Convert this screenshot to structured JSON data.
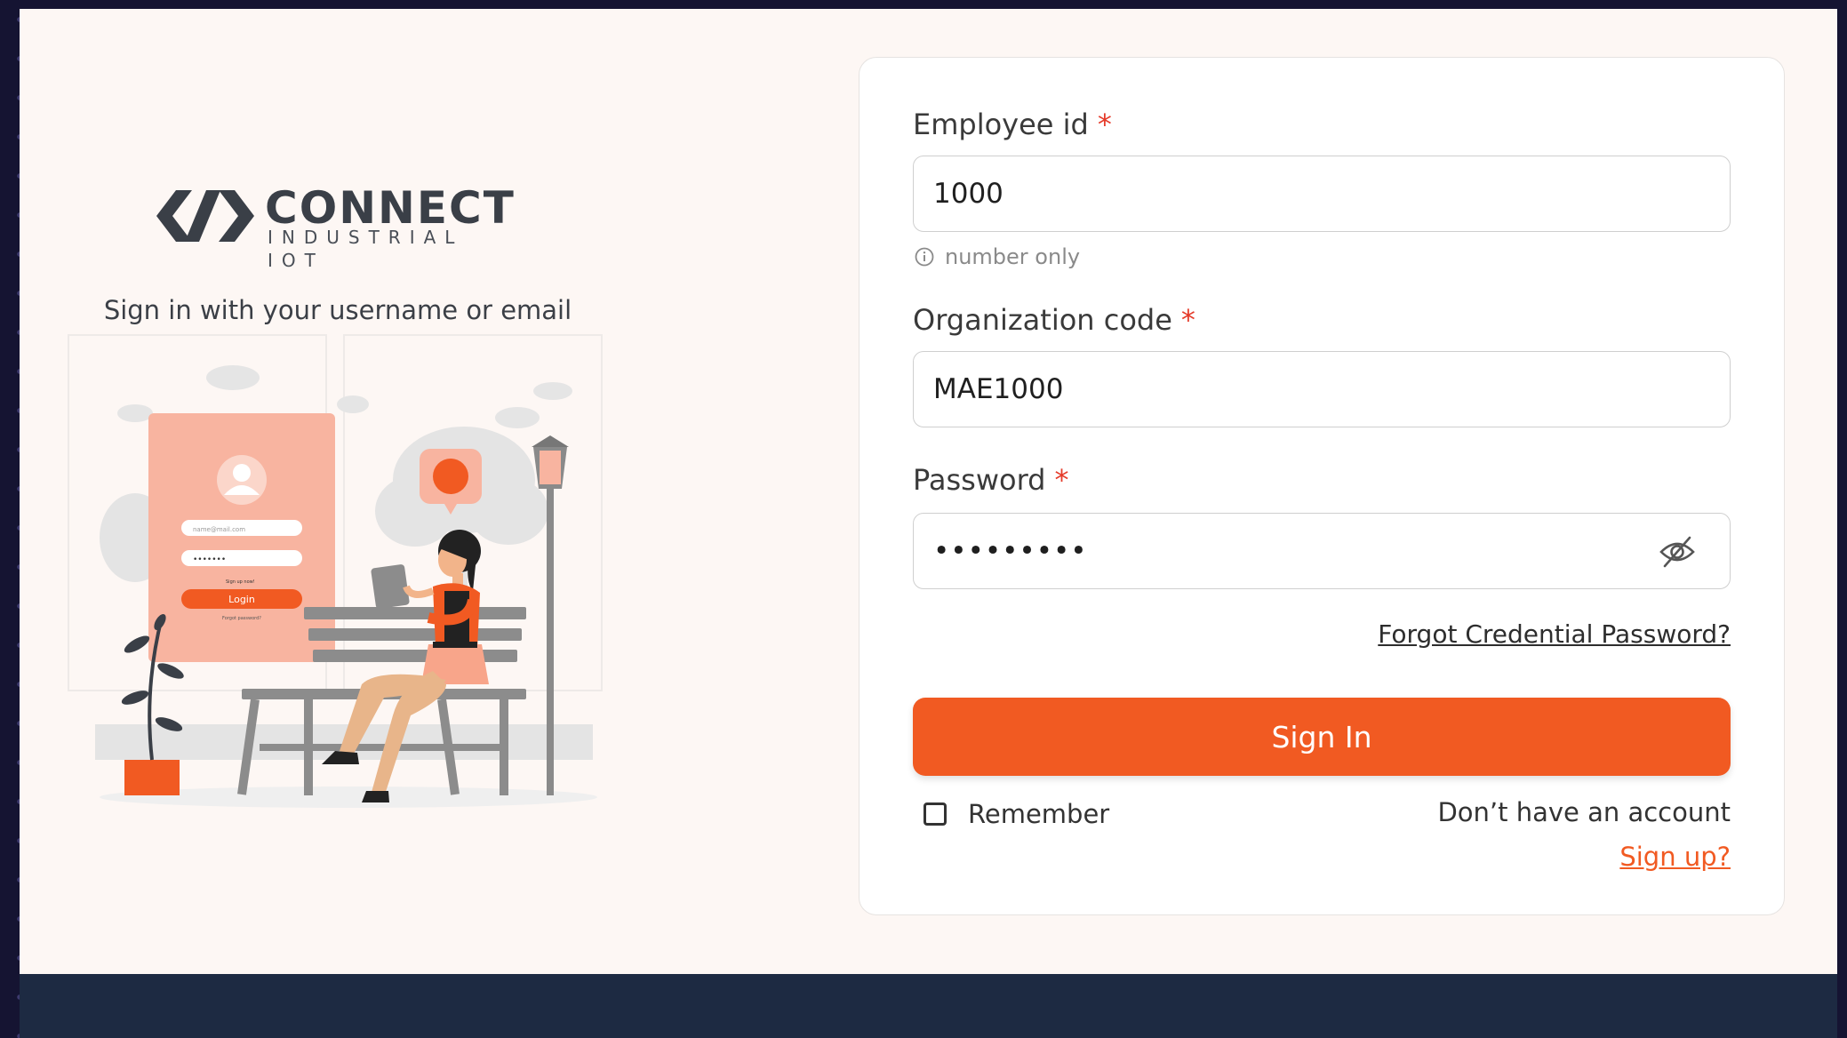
{
  "brand": {
    "name": "CONNECT",
    "tagline": "INDUSTRIAL IOT"
  },
  "subtitle": "Sign in with your username or email",
  "illustration": {
    "email_placeholder": "name@mail.com",
    "password_dots": "•••••••",
    "signup_text": "Sign up now!",
    "login_label": "Login",
    "forgot_text": "Forgot password?"
  },
  "form": {
    "employee_id": {
      "label": "Employee id",
      "required_mark": "*",
      "value": "1000",
      "hint": "number only"
    },
    "organization_code": {
      "label": "Organization code",
      "required_mark": "*",
      "value": "MAE1000"
    },
    "password": {
      "label": "Password",
      "required_mark": "*",
      "value": "•••••••••"
    },
    "forgot_link": "Forgot Credential Password?",
    "signin_label": "Sign In",
    "remember_label": "Remember",
    "no_account_text": "Don’t have an account",
    "signup_link": "Sign up?"
  },
  "colors": {
    "accent": "#f15a22",
    "required": "#e53b2a",
    "footer": "#1d2a42",
    "page_bg": "#fdf7f4"
  }
}
